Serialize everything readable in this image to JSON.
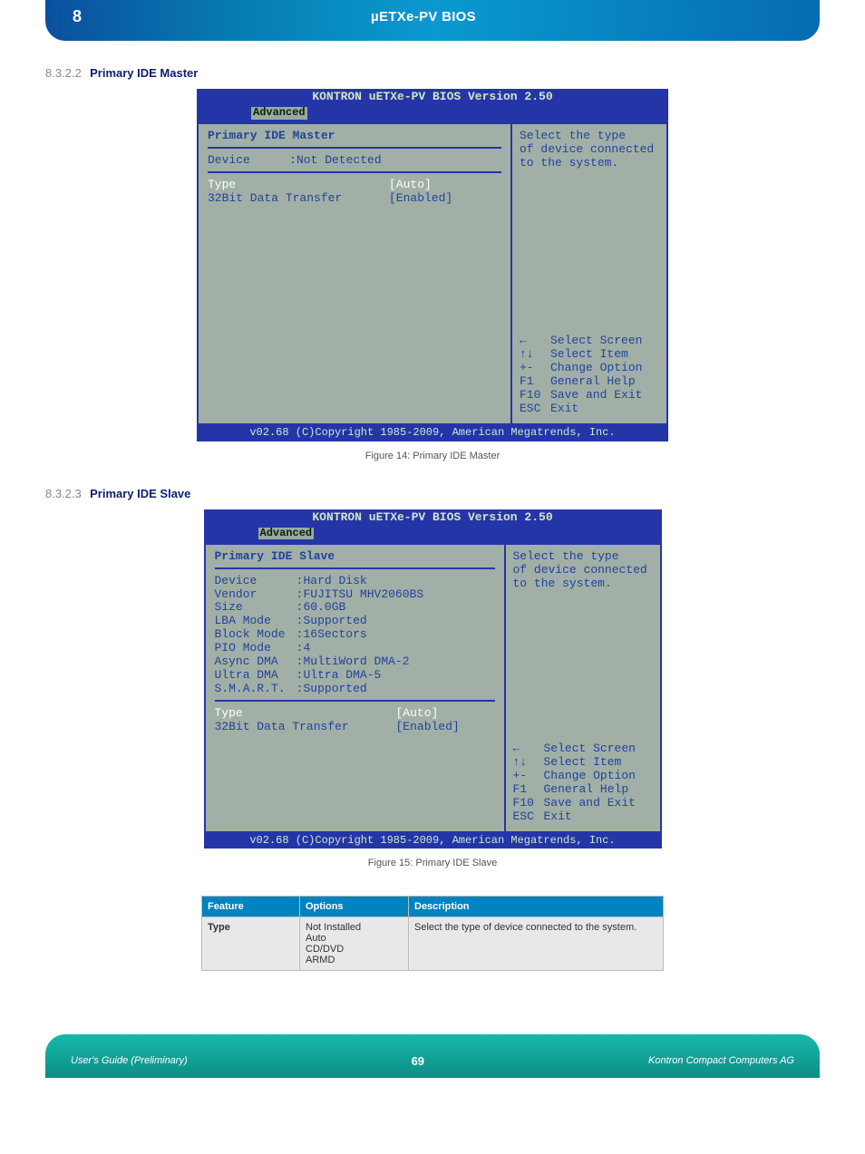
{
  "banner": {
    "chapter": "8",
    "title": "µETXe-PV  BIOS"
  },
  "sectionA": {
    "num": "8.3.2.2",
    "text": "Primary IDE Master",
    "caption": "Figure 14: Primary IDE Master"
  },
  "sectionB": {
    "num": "8.3.2.3",
    "text": "Primary IDE Slave",
    "caption": "Figure 15: Primary IDE Slave"
  },
  "bios": {
    "version": "KONTRON uETXe-PV BIOS Version 2.50",
    "tab": "Advanced",
    "footer": "v02.68 (C)Copyright 1985-2009, American Megatrends, Inc.",
    "master": {
      "title": "Primary IDE Master",
      "device_label": "Device",
      "device_val": "Not Detected"
    },
    "slave": {
      "title": "Primary IDE Slave",
      "rows": [
        {
          "k": "Device",
          "v": "Hard Disk"
        },
        {
          "k": "Vendor",
          "v": "FUJITSU MHV2060BS"
        },
        {
          "k": "Size",
          "v": "60.0GB"
        },
        {
          "k": "LBA Mode",
          "v": "Supported"
        },
        {
          "k": "Block Mode",
          "v": "16Sectors"
        },
        {
          "k": "PIO Mode",
          "v": "4"
        },
        {
          "k": "Async DMA",
          "v": "MultiWord DMA-2"
        },
        {
          "k": "Ultra DMA",
          "v": "Ultra DMA-5"
        },
        {
          "k": "S.M.A.R.T.",
          "v": "Supported"
        }
      ]
    },
    "opts": {
      "type_label": "Type",
      "type_val": "[Auto]",
      "xfer_label": "32Bit Data Transfer",
      "xfer_val": "[Enabled]"
    },
    "help": {
      "line1": "Select the type",
      "line2": "of device connected",
      "line3": "to the system."
    },
    "keys": [
      {
        "k": "←",
        "t": "Select Screen"
      },
      {
        "k": "↑↓",
        "t": "Select Item"
      },
      {
        "k": "+-",
        "t": "Change Option"
      },
      {
        "k": "F1",
        "t": "General Help"
      },
      {
        "k": "F10",
        "t": "Save and Exit"
      },
      {
        "k": "ESC",
        "t": "Exit"
      }
    ]
  },
  "table": {
    "headers": [
      "Feature",
      "Options",
      "Description"
    ],
    "rows": [
      {
        "f": "Type",
        "o": "Not Installed\nAuto\nCD/DVD\nARMD",
        "d": "Select the type of device connected to the system."
      }
    ]
  },
  "footer": {
    "left": "User's Guide (Preliminary)",
    "center": "69",
    "right": "Kontron Compact Computers AG"
  }
}
